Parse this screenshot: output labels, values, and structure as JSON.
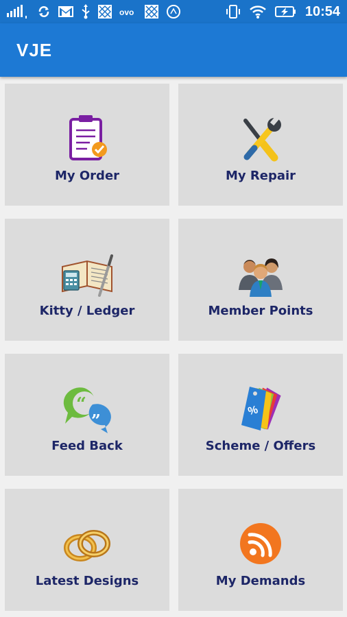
{
  "status_bar": {
    "time": "10:54",
    "left_icons": [
      "signal-icon",
      "sync-icon",
      "gmail-icon",
      "usb-icon",
      "app-icon",
      "ovo-icon",
      "app-icon",
      "clock-app-icon"
    ],
    "right_icons": [
      "vibrate-icon",
      "wifi-icon",
      "battery-charging-icon"
    ]
  },
  "app_bar": {
    "title": "VJE"
  },
  "tiles": [
    {
      "label": "My Order",
      "icon": "clipboard-check-icon"
    },
    {
      "label": "My Repair",
      "icon": "tools-icon"
    },
    {
      "label": "Kitty / Ledger",
      "icon": "ledger-book-icon"
    },
    {
      "label": "Member Points",
      "icon": "members-group-icon"
    },
    {
      "label": "Feed Back",
      "icon": "feedback-chat-icon"
    },
    {
      "label": "Scheme / Offers",
      "icon": "offer-tags-icon"
    },
    {
      "label": "Latest Designs",
      "icon": "gold-rings-icon"
    },
    {
      "label": "My Demands",
      "icon": "rss-feed-icon"
    }
  ],
  "colors": {
    "status_bar": "#1a73c9",
    "app_bar": "#1d79d4",
    "tile_background": "#dcdcdc",
    "label_text": "#1d2667"
  }
}
